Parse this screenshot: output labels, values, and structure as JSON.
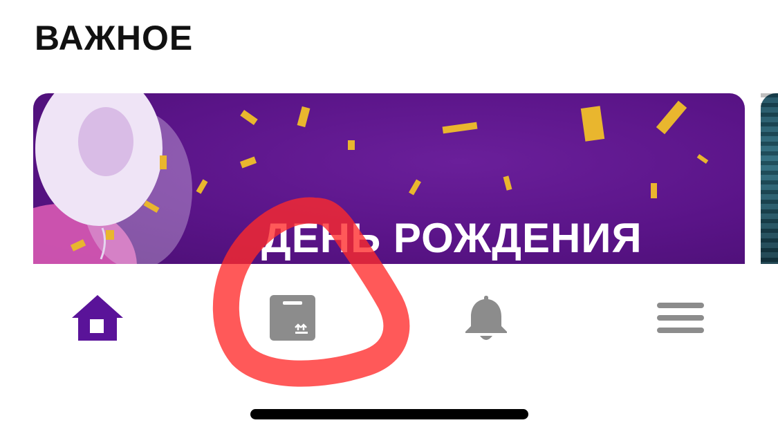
{
  "section": {
    "title": "ВАЖНОЕ"
  },
  "banner": {
    "title": "ДЕНЬ РОЖДЕНИЯ"
  },
  "tabbar": {
    "tabs": [
      {
        "icon": "home-icon",
        "active": true
      },
      {
        "icon": "parcel-box-icon",
        "active": false
      },
      {
        "icon": "bell-icon",
        "active": false
      },
      {
        "icon": "hamburger-menu-icon",
        "active": false
      }
    ]
  },
  "colors": {
    "accent": "#5a1399",
    "inactive_icon": "#8c8c8c",
    "banner_bg": "#5a1488",
    "annotation": "#ff2a2a"
  }
}
